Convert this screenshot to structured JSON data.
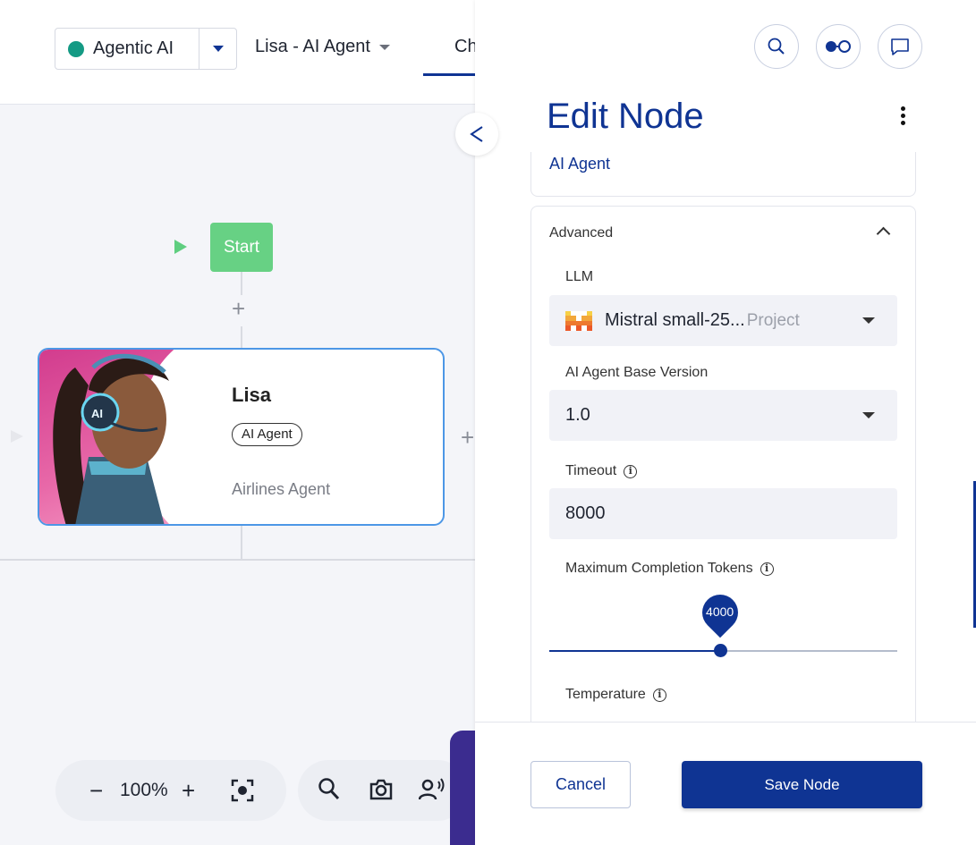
{
  "header": {
    "project": {
      "label": "Agentic AI",
      "status_color": "#149a84"
    },
    "agent_select": {
      "label": "Lisa - AI Agent"
    },
    "tab_partial": "Ch"
  },
  "canvas": {
    "start_node": {
      "label": "Start",
      "color": "#67d184"
    },
    "agent_card": {
      "name": "Lisa",
      "badge": "AI Agent",
      "description": "Airlines Agent",
      "border_color": "#4d97e6"
    },
    "zoom": {
      "minus": "−",
      "value": "100%",
      "plus": "+"
    },
    "tools": [
      "search-icon",
      "camera-icon",
      "voice-icon"
    ]
  },
  "panel": {
    "top_icons": [
      "search-icon",
      "toggle-icon",
      "chat-icon"
    ],
    "title": "Edit Node",
    "subtitle": "AI Agent",
    "advanced": {
      "title": "Advanced",
      "llm": {
        "label": "LLM",
        "name": "Mistral small-25...",
        "tag": "Project"
      },
      "base_version": {
        "label": "AI Agent Base Version",
        "value": "1.0"
      },
      "timeout": {
        "label": "Timeout",
        "value": "8000"
      },
      "max_tokens": {
        "label": "Maximum Completion Tokens",
        "value": "4000",
        "fraction": 0.49
      },
      "temperature": {
        "label": "Temperature"
      }
    },
    "footer": {
      "cancel": "Cancel",
      "save": "Save Node"
    }
  },
  "colors": {
    "primary": "#0f3493",
    "panel_bg": "#ffffff",
    "canvas_bg": "#f4f5f9"
  }
}
